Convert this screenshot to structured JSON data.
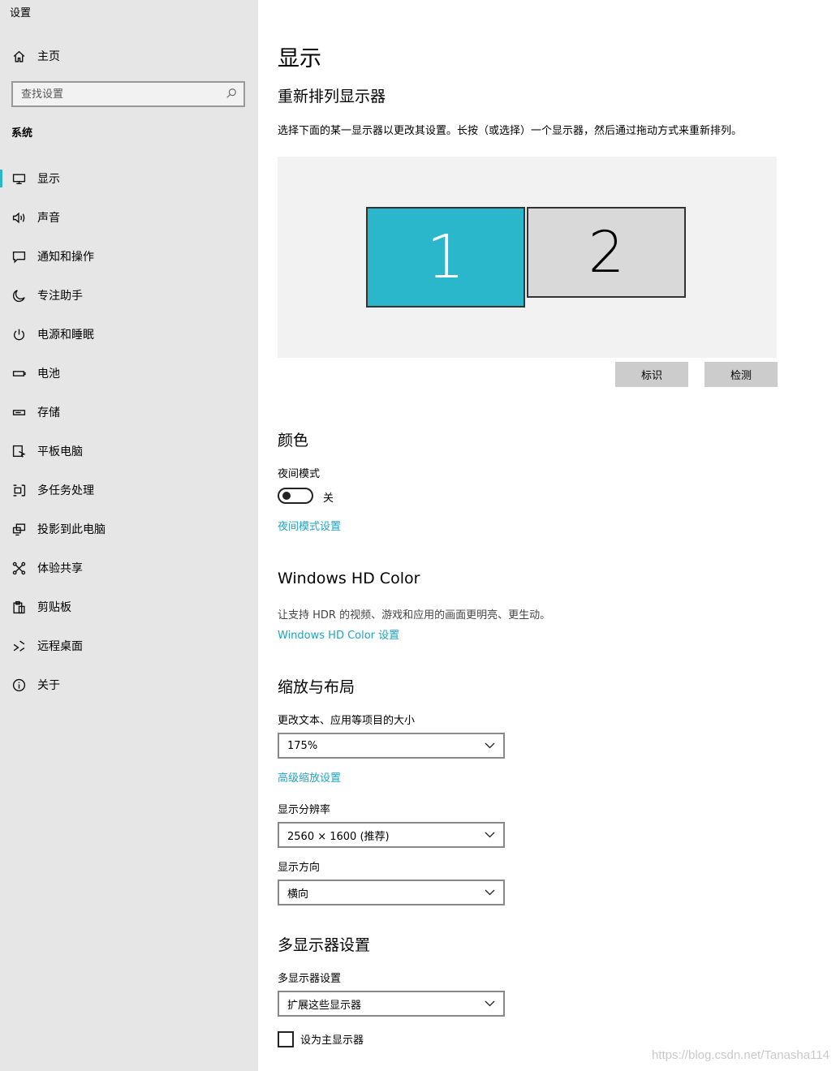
{
  "app": {
    "title": "设置"
  },
  "sidebar": {
    "home_label": "主页",
    "search_placeholder": "查找设置",
    "group_label": "系统",
    "items": [
      {
        "label": "显示",
        "icon": "monitor-icon",
        "active": true
      },
      {
        "label": "声音",
        "icon": "speaker-icon"
      },
      {
        "label": "通知和操作",
        "icon": "notification-icon"
      },
      {
        "label": "专注助手",
        "icon": "moon-icon"
      },
      {
        "label": "电源和睡眠",
        "icon": "power-icon"
      },
      {
        "label": "电池",
        "icon": "battery-icon"
      },
      {
        "label": "存储",
        "icon": "storage-icon"
      },
      {
        "label": "平板电脑",
        "icon": "tablet-icon"
      },
      {
        "label": "多任务处理",
        "icon": "multitask-icon"
      },
      {
        "label": "投影到此电脑",
        "icon": "project-icon"
      },
      {
        "label": "体验共享",
        "icon": "share-icon"
      },
      {
        "label": "剪贴板",
        "icon": "clipboard-icon"
      },
      {
        "label": "远程桌面",
        "icon": "remote-icon"
      },
      {
        "label": "关于",
        "icon": "info-icon"
      }
    ]
  },
  "main": {
    "title": "显示",
    "arrange": {
      "heading": "重新排列显示器",
      "description": "选择下面的某一显示器以更改其设置。长按（或选择）一个显示器，然后通过拖动方式来重新排列。",
      "monitor1": "1",
      "monitor2": "2",
      "identify_label": "标识",
      "detect_label": "检测"
    },
    "color": {
      "heading": "颜色",
      "night_label": "夜间模式",
      "night_state": "关",
      "night_on": false,
      "night_link": "夜间模式设置"
    },
    "hdr": {
      "heading": "Windows HD Color",
      "description": "让支持 HDR 的视频、游戏和应用的画面更明亮、更生动。",
      "link": "Windows HD Color 设置"
    },
    "scale": {
      "heading": "缩放与布局",
      "size_label": "更改文本、应用等项目的大小",
      "size_value": "175%",
      "advanced_link": "高级缩放设置",
      "resolution_label": "显示分辨率",
      "resolution_value": "2560 × 1600 (推荐)",
      "orientation_label": "显示方向",
      "orientation_value": "横向"
    },
    "multi": {
      "heading": "多显示器设置",
      "label": "多显示器设置",
      "value": "扩展这些显示器",
      "primary_label": "设为主显示器",
      "primary_checked": false
    }
  },
  "watermark": "https://blog.csdn.net/Tanasha114",
  "colors": {
    "accent": "#2ab6cb",
    "link": "#1ea3c3",
    "sidebar_bg": "#e6e6e6"
  }
}
